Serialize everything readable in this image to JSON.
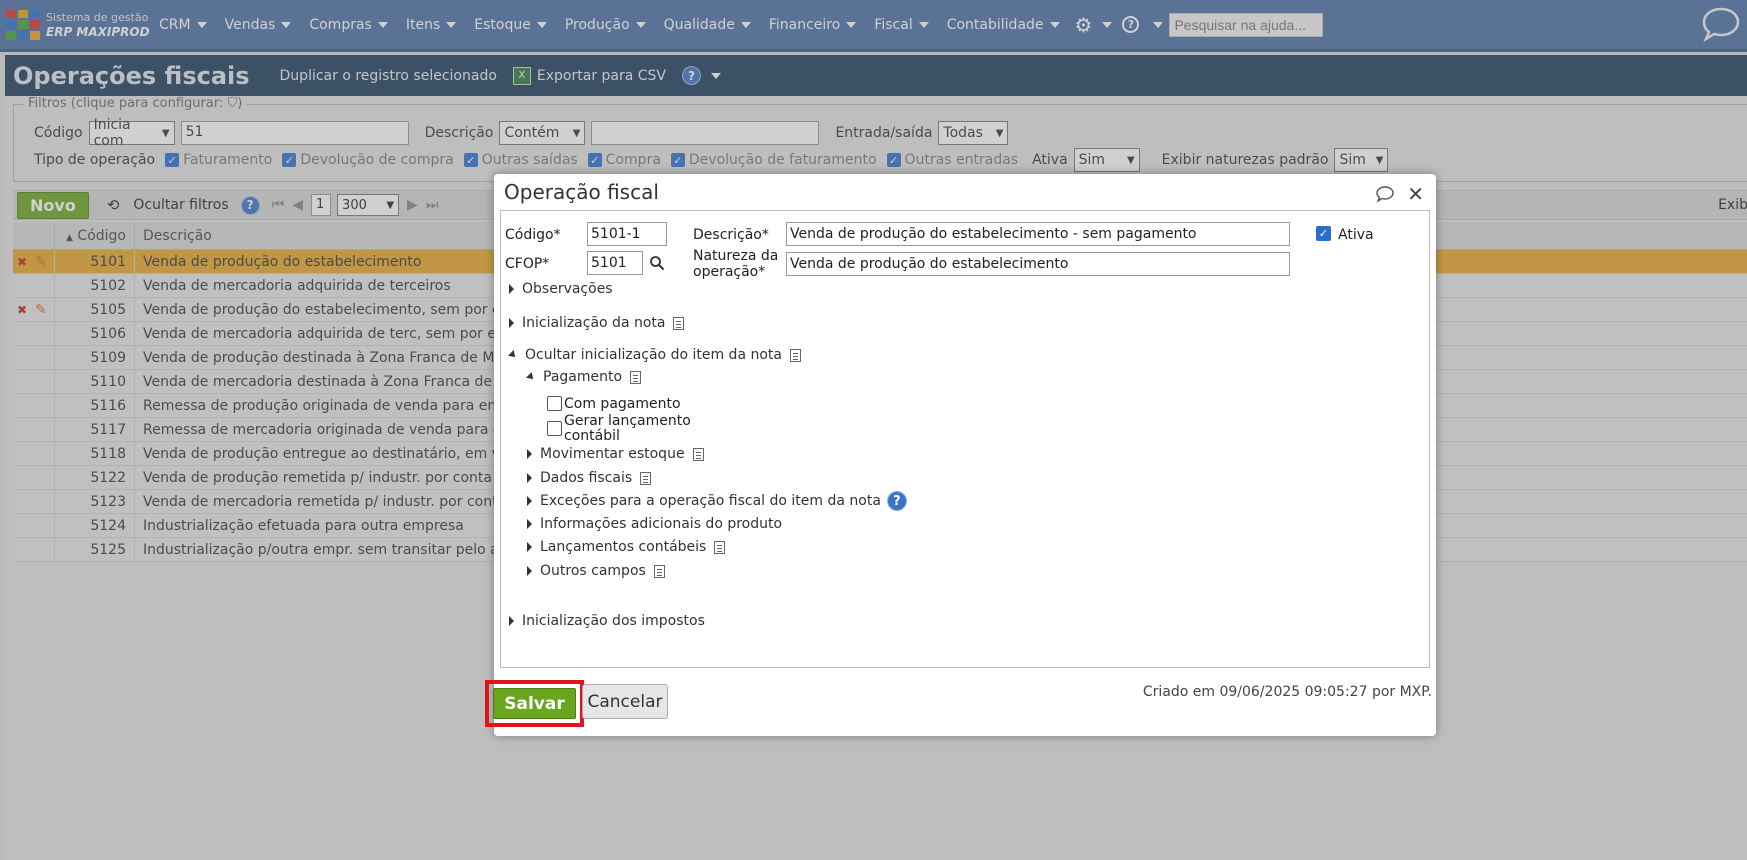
{
  "app": {
    "logo_line1": "Sistema de gestão",
    "logo_line2": "ERP MAXIPROD",
    "logo_colors": [
      "#d8322a",
      "#f0a020",
      "#2a6fd0",
      "#44a23a"
    ]
  },
  "nav": {
    "items": [
      {
        "label": "CRM"
      },
      {
        "label": "Vendas"
      },
      {
        "label": "Compras"
      },
      {
        "label": "Itens"
      },
      {
        "label": "Estoque"
      },
      {
        "label": "Produção"
      },
      {
        "label": "Qualidade"
      },
      {
        "label": "Financeiro"
      },
      {
        "label": "Fiscal"
      },
      {
        "label": "Contabilidade"
      }
    ],
    "help_placeholder": "Pesquisar na ajuda..."
  },
  "page": {
    "title": "Operações fiscais",
    "duplicate_label": "Duplicar o registro selecionado",
    "export_label": "Exportar para CSV"
  },
  "filters": {
    "legend": "Filtros (clique para configurar:",
    "legend_end": ")",
    "codigo_label": "Código",
    "codigo_op": "Inicia com",
    "codigo_value": "51",
    "descricao_label": "Descrição",
    "descricao_op": "Contém",
    "descricao_value": "",
    "entrada_saida_label": "Entrada/saída",
    "entrada_saida_value": "Todas",
    "tipo_label": "Tipo de operação",
    "tipos": [
      "Faturamento",
      "Devolução de compra",
      "Outras saídas",
      "Compra",
      "Devolução de faturamento",
      "Outras entradas"
    ],
    "ativa_label": "Ativa",
    "ativa_value": "Sim",
    "naturezas_label": "Exibir naturezas padrão",
    "naturezas_value": "Sim"
  },
  "toolbar": {
    "novo_label": "Novo",
    "ocultar_filtros_label": "Ocultar filtros",
    "page_number": "1",
    "page_size": "300",
    "exibir_label": "Exib"
  },
  "grid": {
    "col_codigo": "Código",
    "col_descricao": "Descrição",
    "rows": [
      {
        "code": "5101",
        "desc": "Venda de produção do estabelecimento"
      },
      {
        "code": "5102",
        "desc": "Venda de mercadoria adquirida de terceiros"
      },
      {
        "code": "5105",
        "desc": "Venda de produção do estabelecimento, sem por el"
      },
      {
        "code": "5106",
        "desc": "Venda de mercadoria adquirida de terc, sem por el"
      },
      {
        "code": "5109",
        "desc": "Venda de produção destinada à Zona Franca de Ma"
      },
      {
        "code": "5110",
        "desc": "Venda de mercadoria destinada à Zona Franca de M"
      },
      {
        "code": "5116",
        "desc": "Remessa de produção originada de venda para ent"
      },
      {
        "code": "5117",
        "desc": "Remessa de mercadoria originada de venda para e"
      },
      {
        "code": "5118",
        "desc": "Venda de produção entregue ao destinatário, em v"
      },
      {
        "code": "5122",
        "desc": "Venda de produção remetida p/ industr. por conta"
      },
      {
        "code": "5123",
        "desc": "Venda de mercadoria remetida p/ industr. por cont"
      },
      {
        "code": "5124",
        "desc": "Industrialização efetuada para outra empresa"
      },
      {
        "code": "5125",
        "desc": "Industrialização p/outra empr. sem transitar pelo a"
      }
    ]
  },
  "modal": {
    "title": "Operação fiscal",
    "codigo_label": "Código*",
    "codigo_value": "5101-1",
    "descricao_label": "Descrição*",
    "descricao_value": "Venda de produção do estabelecimento - sem pagamento",
    "ativa_label": "Ativa",
    "cfop_label": "CFOP*",
    "cfop_value": "5101",
    "natureza_label_1": "Natureza da",
    "natureza_label_2": "operação*",
    "natureza_value": "Venda de produção do estabelecimento",
    "sections": {
      "observacoes": "Observações",
      "inicializacao_nota": "Inicialização da nota",
      "ocultar_item": "Ocultar inicialização do item da nota",
      "pagamento": "Pagamento",
      "com_pagamento": "Com pagamento",
      "gerar_lancamento_1": "Gerar lançamento",
      "gerar_lancamento_2": "contábil",
      "movimentar_estoque": "Movimentar estoque",
      "dados_fiscais": "Dados fiscais",
      "excecoes": "Exceções para a operação fiscal do item da nota",
      "info_adicionais": "Informações adicionais do produto",
      "lancamentos": "Lançamentos contábeis",
      "outros_campos": "Outros campos",
      "impostos": "Inicialização dos impostos"
    },
    "save_label": "Salvar",
    "cancel_label": "Cancelar",
    "created_text": "Criado em 09/06/2025 09:05:27 por MXP."
  }
}
